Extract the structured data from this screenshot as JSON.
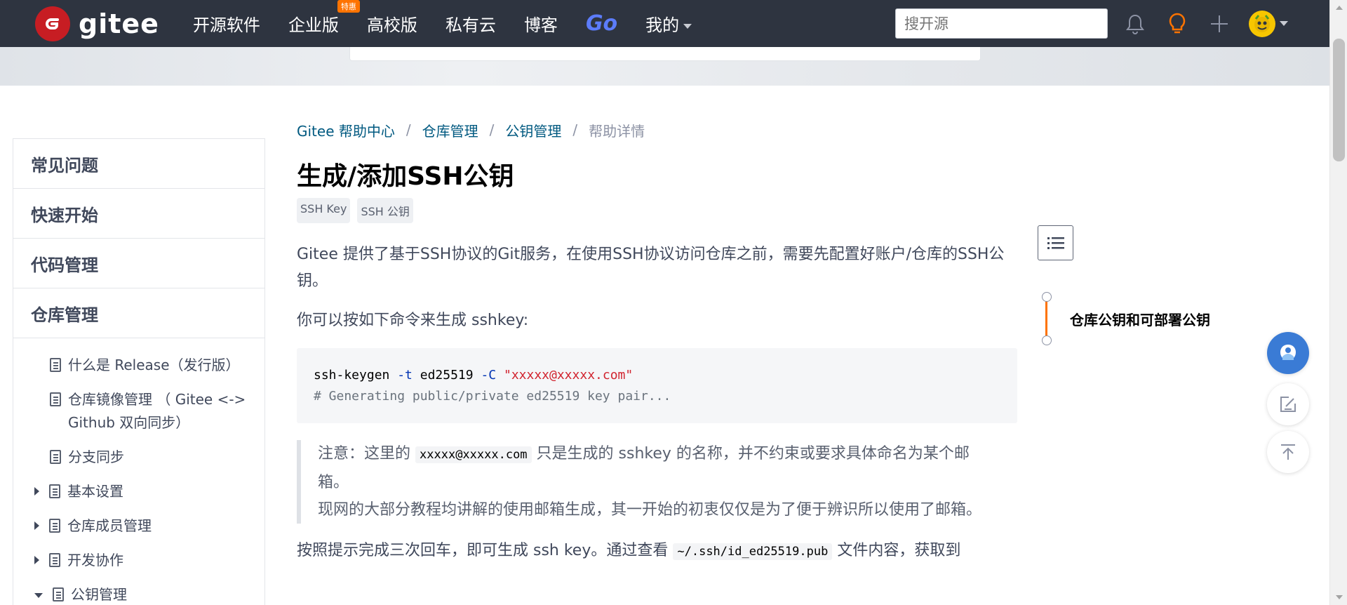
{
  "header": {
    "logo_text": "gitee",
    "nav": [
      {
        "label": "开源软件"
      },
      {
        "label": "企业版",
        "badge": "特惠"
      },
      {
        "label": "高校版"
      },
      {
        "label": "私有云"
      },
      {
        "label": "博客"
      },
      {
        "label": "Go"
      },
      {
        "label": "我的"
      }
    ],
    "search_placeholder": "搜开源"
  },
  "sidebar": {
    "groups": [
      "常见问题",
      "快速开始",
      "代码管理",
      "仓库管理"
    ],
    "items": [
      {
        "label": "什么是 Release（发行版）"
      },
      {
        "label": "仓库镜像管理 （ Gitee <-> Github 双向同步）"
      },
      {
        "label": "分支同步"
      },
      {
        "label": "基本设置"
      },
      {
        "label": "仓库成员管理"
      },
      {
        "label": "开发协作"
      },
      {
        "label": "公钥管理"
      }
    ]
  },
  "breadcrumb": {
    "items": [
      "Gitee 帮助中心",
      "仓库管理",
      "公钥管理"
    ],
    "current": "帮助详情",
    "separator": "/"
  },
  "article": {
    "title": "生成/添加SSH公钥",
    "tags": [
      "SSH Key",
      "SSH 公钥"
    ],
    "p1": "Gitee 提供了基于SSH协议的Git服务，在使用SSH协议访问仓库之前，需要先配置好账户/仓库的SSH公钥。",
    "p2": "你可以按如下命令来生成 sshkey:",
    "code": {
      "cmd": "ssh-keygen",
      "flag_t": "-t",
      "arg_t": "ed25519",
      "flag_c": "-C",
      "arg_c": "\"xxxxx@xxxxx.com\"",
      "comment": "# Generating public/private ed25519 key pair..."
    },
    "note": {
      "prefix": "注意：这里的",
      "code": "xxxxx@xxxxx.com",
      "suffix": "只是生成的 sshkey 的名称，并不约束或要求具体命名为某个邮箱。",
      "line2": "现网的大部分教程均讲解的使用邮箱生成，其一开始的初衷仅仅是为了便于辨识所以使用了邮箱。"
    },
    "p3": {
      "prefix": "按照提示完成三次回车，即可生成 ssh key。通过查看",
      "code": "~/.ssh/id_ed25519.pub",
      "suffix": "文件内容，获取到"
    }
  },
  "toc": {
    "item": "仓库公钥和可部署公钥"
  },
  "colors": {
    "nav_bg": "#2e3440",
    "brand_red": "#c71d23",
    "accent_orange": "#fe7300",
    "link_blue": "#005980",
    "fab_blue": "#3a7bd5"
  },
  "icons": [
    "logo-icon",
    "bell-icon",
    "bulb-icon",
    "plus-icon",
    "avatar-icon",
    "toc-list-icon",
    "chat-icon",
    "edit-icon",
    "back-to-top-icon"
  ]
}
